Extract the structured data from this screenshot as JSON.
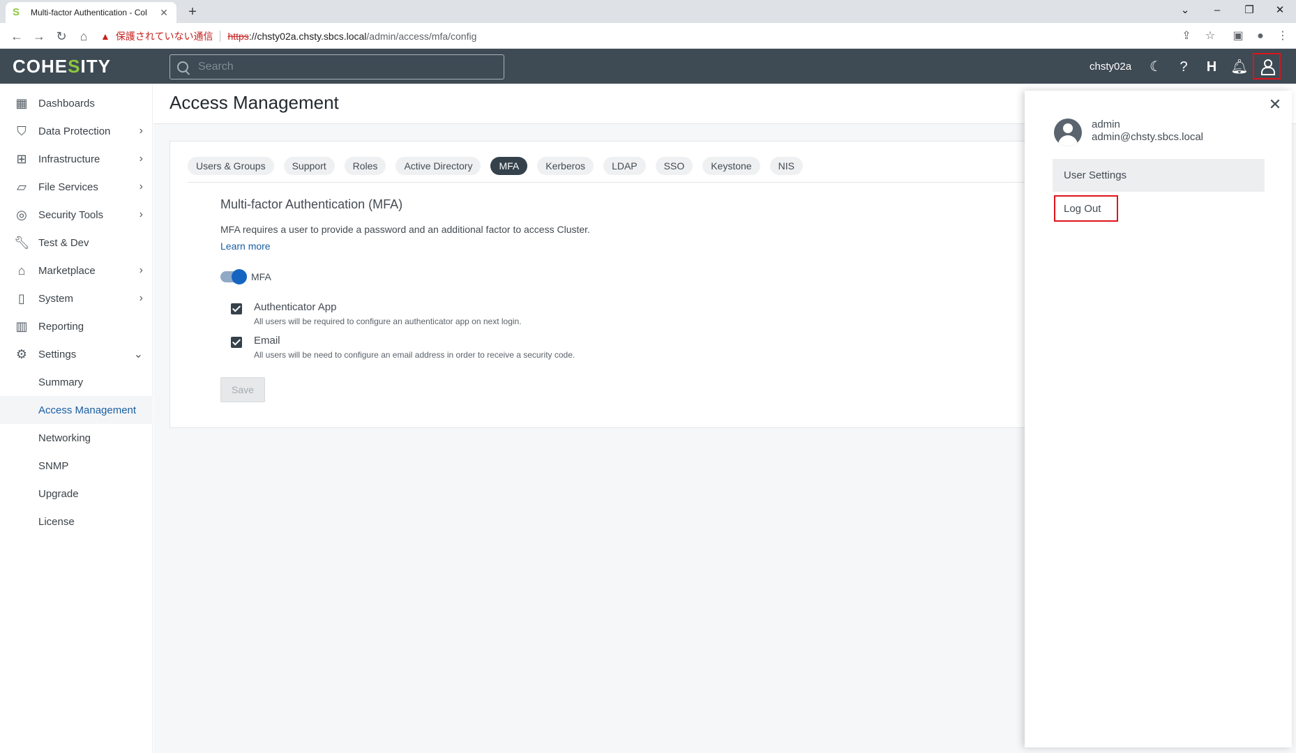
{
  "browser": {
    "tab_title": "Multi-factor Authentication - Col",
    "tab_favicon": "S",
    "security_warning": "保護されていない通信",
    "url_protocol": "https",
    "url_host": "://chsty02a.chsty.sbcs.local",
    "url_path": "/admin/access/mfa/config"
  },
  "header": {
    "logo_prefix": "COHE",
    "logo_accent": "S",
    "logo_suffix": "ITY",
    "search_placeholder": "Search",
    "cluster_name": "chsty02a"
  },
  "sidebar": {
    "items": [
      {
        "label": "Dashboards",
        "icon": "dashboard-icon"
      },
      {
        "label": "Data Protection",
        "icon": "shield-icon"
      },
      {
        "label": "Infrastructure",
        "icon": "infrastructure-icon"
      },
      {
        "label": "File Services",
        "icon": "folder-icon"
      },
      {
        "label": "Security Tools",
        "icon": "fingerprint-icon"
      },
      {
        "label": "Test & Dev",
        "icon": "wrench-icon"
      },
      {
        "label": "Marketplace",
        "icon": "store-icon"
      },
      {
        "label": "System",
        "icon": "system-icon"
      },
      {
        "label": "Reporting",
        "icon": "chart-icon"
      },
      {
        "label": "Settings",
        "icon": "gear-icon"
      }
    ],
    "settings_children": [
      {
        "label": "Summary"
      },
      {
        "label": "Access Management"
      },
      {
        "label": "Networking"
      },
      {
        "label": "SNMP"
      },
      {
        "label": "Upgrade"
      },
      {
        "label": "License"
      }
    ]
  },
  "main": {
    "page_title": "Access Management",
    "tabs": [
      {
        "label": "Users & Groups"
      },
      {
        "label": "Support"
      },
      {
        "label": "Roles"
      },
      {
        "label": "Active Directory"
      },
      {
        "label": "MFA"
      },
      {
        "label": "Kerberos"
      },
      {
        "label": "LDAP"
      },
      {
        "label": "SSO"
      },
      {
        "label": "Keystone"
      },
      {
        "label": "NIS"
      }
    ],
    "active_tab": "MFA",
    "section_title": "Multi-factor Authentication (MFA)",
    "description": "MFA requires a user to provide a password and an additional factor to access Cluster.",
    "learn_more": "Learn more",
    "toggle_label": "MFA",
    "options": [
      {
        "title": "Authenticator App",
        "subtitle": "All users will be required to configure an authenticator app on next login.",
        "checked": true
      },
      {
        "title": "Email",
        "subtitle": "All users will be need to configure an email address in order to receive a security code.",
        "checked": true
      }
    ],
    "save_label": "Save"
  },
  "user_panel": {
    "username": "admin",
    "email": "admin@chsty.sbcs.local",
    "user_settings_label": "User Settings",
    "logout_label": "Log Out"
  }
}
